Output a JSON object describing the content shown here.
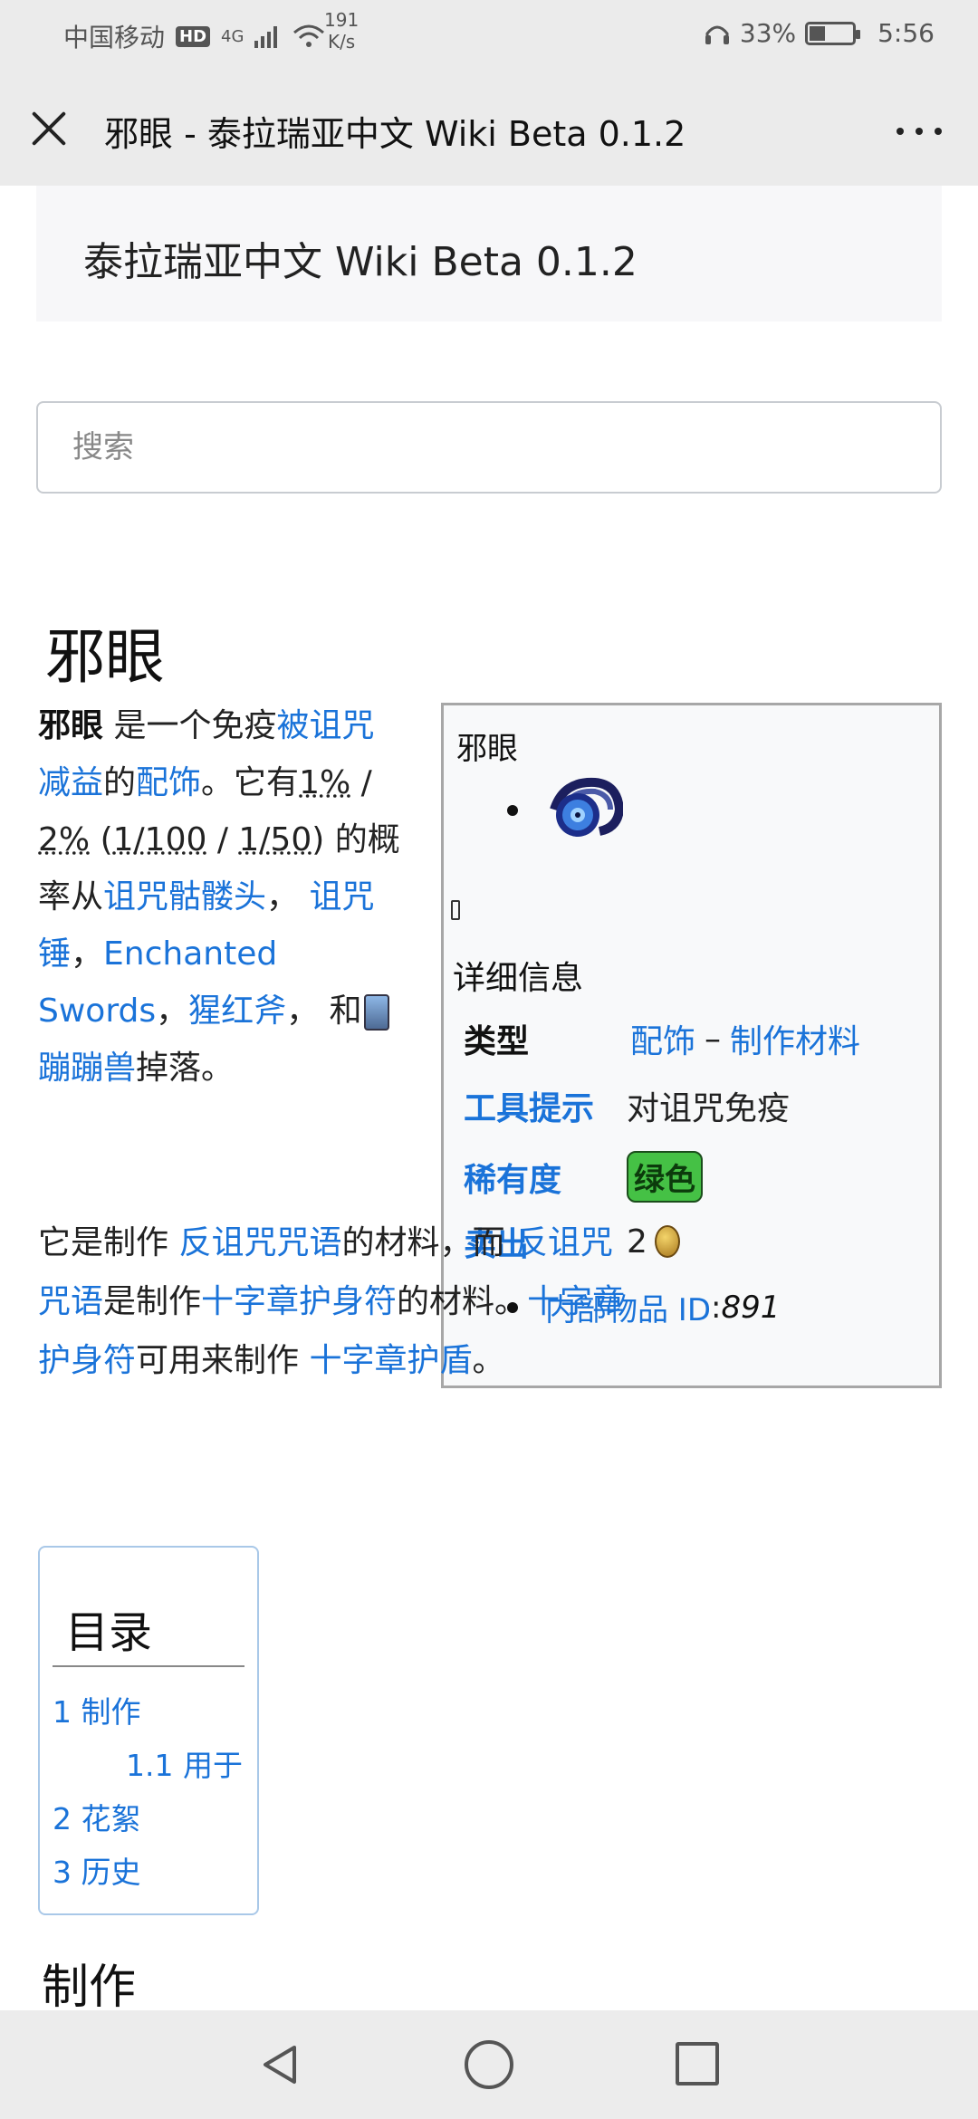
{
  "status_bar": {
    "carrier": "中国移动",
    "network_badge": "HD",
    "signal": "4G",
    "speed_value": "191",
    "speed_unit": "K/s",
    "battery": "33%",
    "time": "5:56"
  },
  "title_bar": {
    "title": "邪眼 - 泰拉瑞亚中文 Wiki Beta 0.1.2"
  },
  "wiki_header": {
    "site_title": "泰拉瑞亚中文 Wiki Beta 0.1.2"
  },
  "search": {
    "placeholder": "搜索"
  },
  "page": {
    "title": "邪眼"
  },
  "intro": {
    "item_name": "邪眼",
    "t1": " 是一个免疫",
    "link_cursed": "被诅咒减益",
    "t2": "的",
    "link_accessory": "配饰",
    "t3": "。它有",
    "p1": "1%",
    "sep1": " / ",
    "p2": "2%",
    "t4": " (",
    "f1": "1/100",
    "sep2": " / ",
    "f2": "1/50",
    "t5": ") 的概率从",
    "link_cursed_skull": "诅咒骷髅头",
    "t6": "， ",
    "link_cursed_hammer": "诅咒锤",
    "t7": "，",
    "link_enchanted_swords": "Enchanted Swords",
    "t8": "，",
    "link_crimson_axe": "猩红斧",
    "t9": "， 和",
    "link_hopper": "蹦蹦兽",
    "t10": "掉落。"
  },
  "para2": {
    "t1": "它是制作 ",
    "link_countercurse1": "反诅咒咒语",
    "t2": "的材料，而 ",
    "link_countercurse2": "反诅咒咒语",
    "t3": "是制作",
    "link_ankh1": "十字章护身符",
    "t4": "的材料。",
    "link_ankh2": "十字章护身符",
    "t5": "可用来制作 ",
    "link_ankh_shield": "十字章护盾",
    "t6": "。"
  },
  "infobox": {
    "name": "邪眼",
    "details_title": "详细信息",
    "type_label": "类型",
    "type_value_1": "配饰",
    "type_sep": " – ",
    "type_value_2": "制作材料",
    "tooltip_label": "工具提示",
    "tooltip_value": "对诅咒免疫",
    "rarity_label": "稀有度",
    "rarity_value": "绿色",
    "sell_label": "卖出",
    "sell_value": "2",
    "id_label": "内部物品 ID",
    "id_colon": ": ",
    "id_value": "891"
  },
  "toc": {
    "title": "目录",
    "items": [
      {
        "num": "1",
        "label": "制作"
      },
      {
        "num": "1.1",
        "label": "用于"
      },
      {
        "num": "2",
        "label": "花絮"
      },
      {
        "num": "3",
        "label": "历史"
      }
    ]
  },
  "section": {
    "heading": "制作"
  },
  "colors": {
    "link": "#1a73d9",
    "rarity_green": "#45c145",
    "header_bg": "#ebebeb"
  }
}
